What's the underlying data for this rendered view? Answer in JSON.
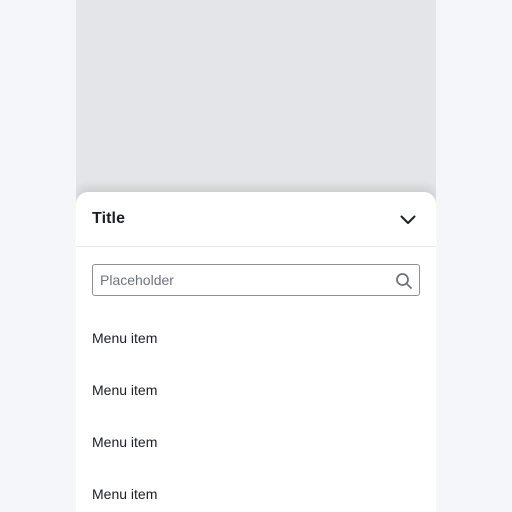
{
  "sheet": {
    "title": "Title",
    "collapse_icon": "chevron-down-icon"
  },
  "search": {
    "placeholder": "Placeholder",
    "value": "",
    "icon": "search-icon"
  },
  "menu": {
    "items": [
      {
        "label": "Menu item"
      },
      {
        "label": "Menu item"
      },
      {
        "label": "Menu item"
      },
      {
        "label": "Menu item"
      }
    ]
  },
  "colors": {
    "page_background": "#f5f6fa",
    "backdrop": "#e3e5e8",
    "sheet_background": "#ffffff",
    "text": "#1c1e21",
    "border": "#8d9096"
  }
}
